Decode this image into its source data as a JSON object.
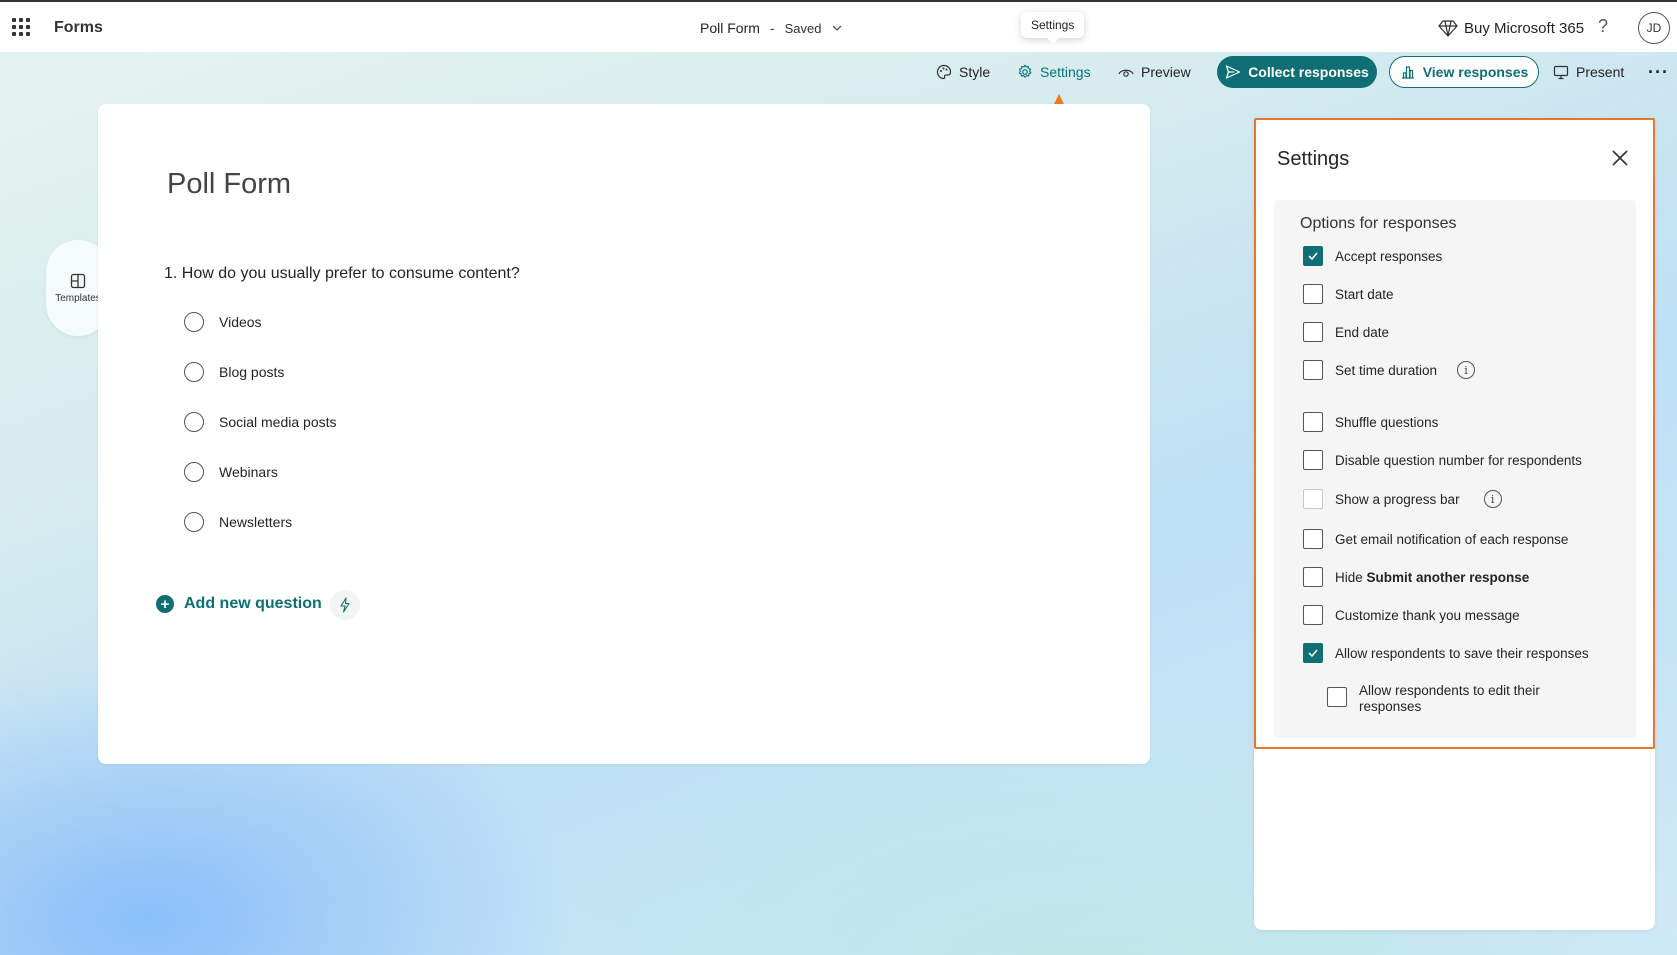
{
  "header": {
    "app_name": "Forms",
    "form_title": "Poll Form",
    "separator": "-",
    "status": "Saved",
    "buy_label": "Buy Microsoft 365",
    "help_label": "?",
    "avatar_initials": "JD"
  },
  "tooltip": {
    "text": "Settings"
  },
  "toolbar": {
    "style_label": "Style",
    "settings_label": "Settings",
    "preview_label": "Preview",
    "collect_label": "Collect responses",
    "view_label": "View responses",
    "present_label": "Present",
    "more_label": "···"
  },
  "sidebar": {
    "templates_label": "Templates"
  },
  "form": {
    "title": "Poll Form",
    "question": "1. How do you usually prefer to consume content?",
    "options": [
      "Videos",
      "Blog posts",
      "Social media posts",
      "Webinars",
      "Newsletters"
    ],
    "add_question_label": "Add new question"
  },
  "settings": {
    "title": "Settings",
    "section_heading": "Options for responses",
    "items": [
      {
        "label": "Accept responses",
        "checked": true
      },
      {
        "label": "Start date",
        "checked": false
      },
      {
        "label": "End date",
        "checked": false
      },
      {
        "label": "Set time duration",
        "checked": false,
        "info": true
      },
      {
        "label": "Shuffle questions",
        "checked": false
      },
      {
        "label": "Disable question number for respondents",
        "checked": false
      },
      {
        "label": "Show a progress bar",
        "checked": false,
        "info": true,
        "disabled": true
      },
      {
        "label": "Get email notification of each response",
        "checked": false
      },
      {
        "label_prefix": "Hide ",
        "label_bold": "Submit another response",
        "checked": false
      },
      {
        "label": "Customize thank you message",
        "checked": false
      },
      {
        "label": "Allow respondents to save their responses",
        "checked": true
      },
      {
        "label": "Allow respondents to edit their responses",
        "checked": false,
        "sub": true
      }
    ],
    "info_glyph": "i"
  },
  "colors": {
    "accent": "#0f6f75",
    "highlight": "#e8742e"
  }
}
